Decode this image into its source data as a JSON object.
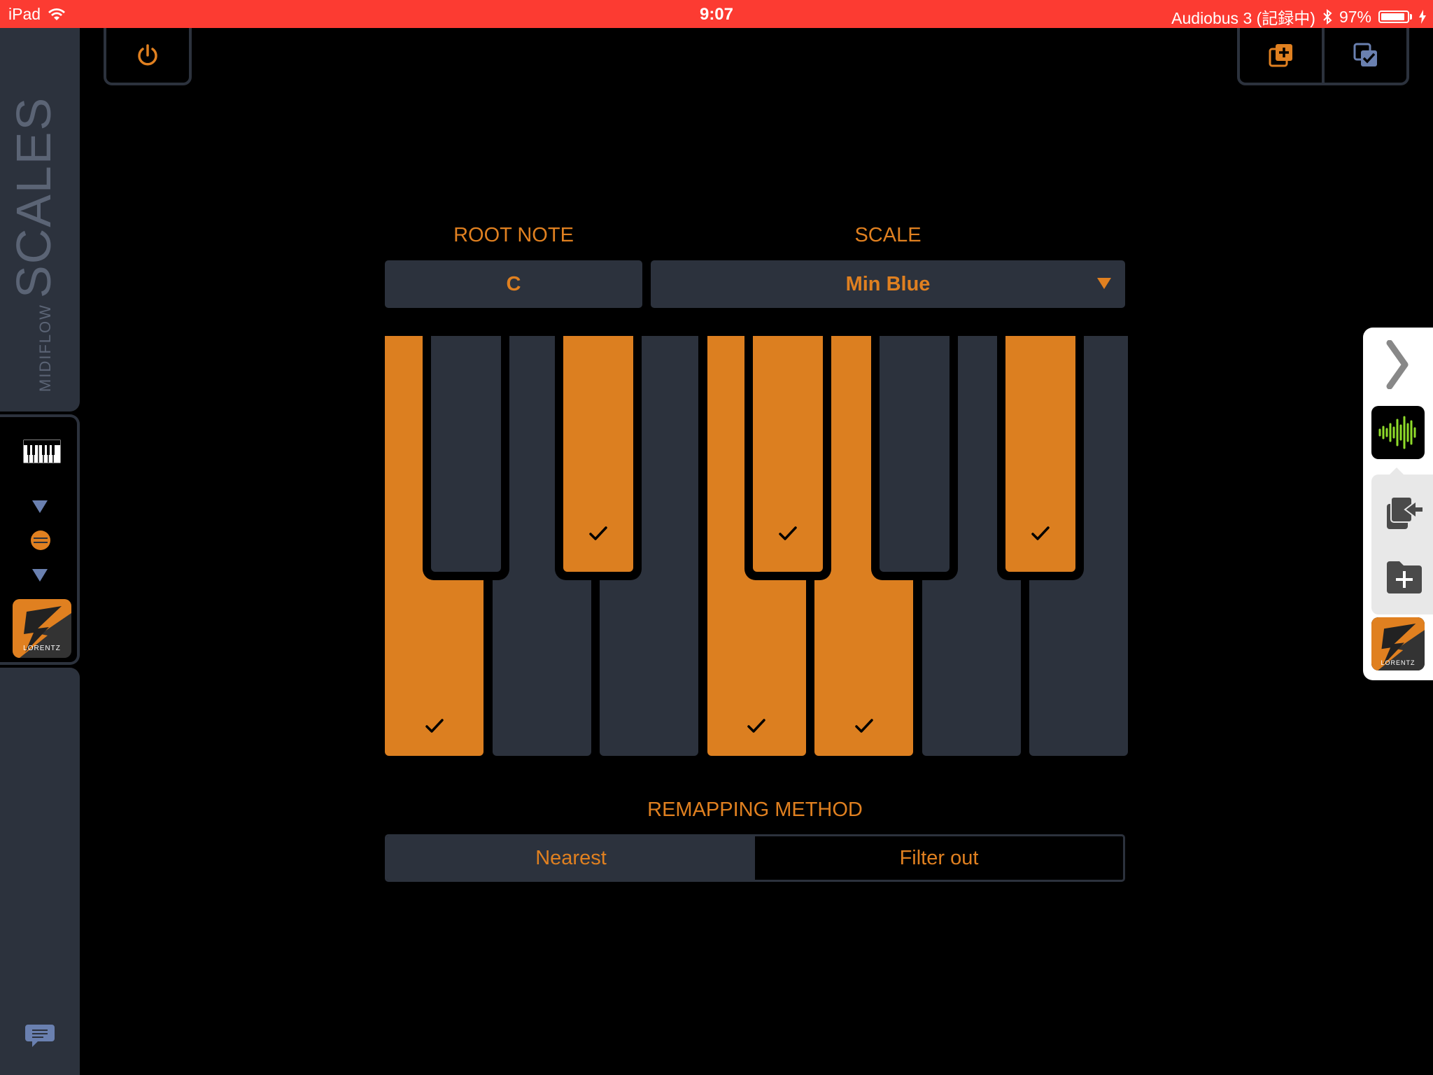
{
  "status_bar": {
    "device": "iPad",
    "time": "9:07",
    "app": "Audiobus 3 (記録中)",
    "battery": "97%",
    "battery_level": 0.97
  },
  "sidebar": {
    "brand_small": "MIDIFLOW",
    "brand_big": "SCALES",
    "lorentz_label": "LORENTZ"
  },
  "root_note": {
    "label": "ROOT NOTE",
    "value": "C"
  },
  "scale": {
    "label": "SCALE",
    "value": "Min Blue"
  },
  "keyboard": {
    "white_keys": [
      {
        "note": "C",
        "on": true
      },
      {
        "note": "D",
        "on": false
      },
      {
        "note": "E",
        "on": false
      },
      {
        "note": "F",
        "on": true
      },
      {
        "note": "G",
        "on": true
      },
      {
        "note": "A",
        "on": false
      },
      {
        "note": "B",
        "on": false
      }
    ],
    "black_keys": [
      {
        "note": "C#",
        "on": false
      },
      {
        "note": "D#",
        "on": true
      },
      {
        "note": "F#",
        "on": true
      },
      {
        "note": "G#",
        "on": false
      },
      {
        "note": "A#",
        "on": true
      }
    ]
  },
  "remapping": {
    "label": "REMAPPING METHOD",
    "options": [
      "Nearest",
      "Filter out"
    ],
    "selected": "Nearest"
  },
  "right_panel": {
    "lorentz_label": "LORENTZ"
  },
  "colors": {
    "accent": "#dc7f20",
    "panel": "#2c323d",
    "status_bar": "#fc3b32"
  }
}
